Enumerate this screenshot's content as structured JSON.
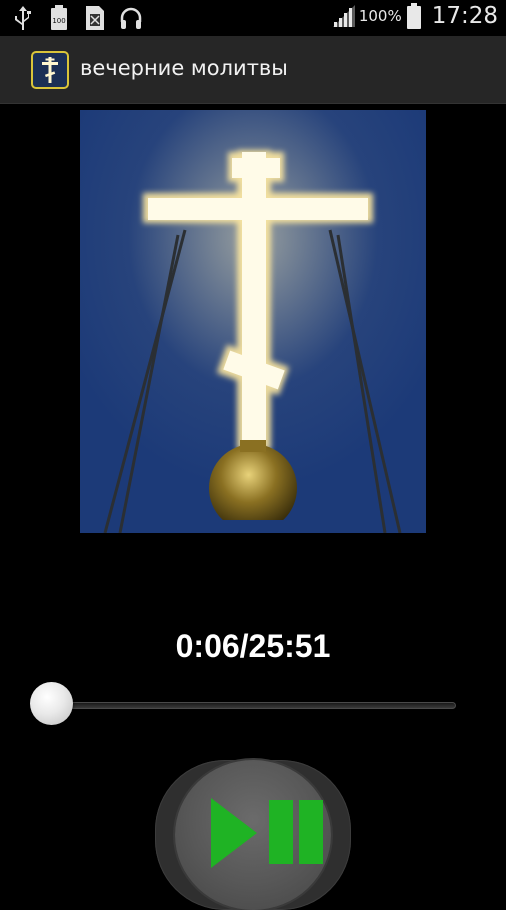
{
  "status_bar": {
    "icons": [
      "usb-icon",
      "battery-full-notification-icon",
      "sim-card-icon",
      "headphones-icon",
      "signal-icon",
      "battery-icon"
    ],
    "battery_percent": "100%",
    "time": "17:28"
  },
  "action_bar": {
    "app_icon": "orthodox-cross-icon",
    "title": "вечерние молитвы"
  },
  "player": {
    "cover_art": "orthodox-cross-icon",
    "time_readout": "0:06/25:51",
    "progress_fraction": 0.004,
    "play_pause": "play-pause-icon"
  },
  "colors": {
    "accent": "#1fb324",
    "action_bar_bg": "#262626",
    "background": "#000000"
  }
}
